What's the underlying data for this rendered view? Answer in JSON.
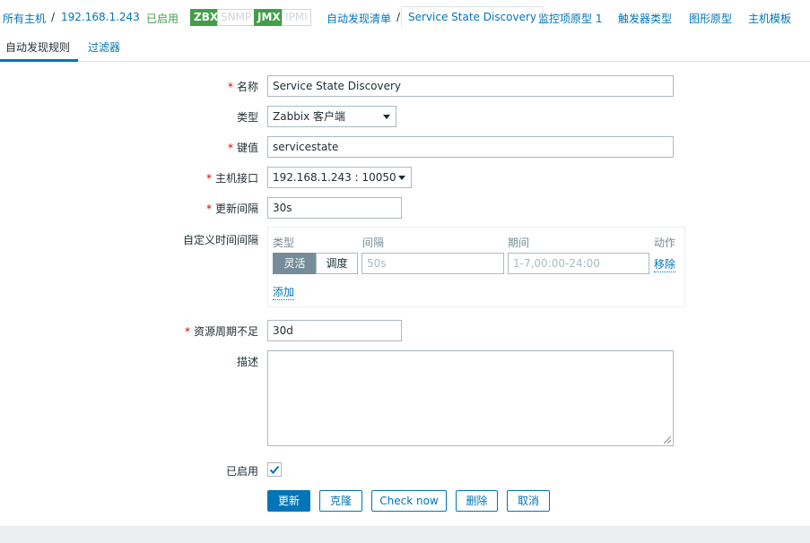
{
  "nav": {
    "all_hosts": "所有主机",
    "host": "192.168.1.243",
    "enabled": "已启用",
    "badges": [
      "ZBX",
      "SNMP",
      "JMX",
      "IPMI"
    ],
    "discovery_list": "自动发现清单",
    "current": "Service State Discovery",
    "item_prototypes": "监控项原型 1",
    "trigger_types": "触发器类型",
    "graph_prototypes": "图形原型",
    "host_templates": "主机模板"
  },
  "tabs": [
    "自动发现规则",
    "过滤器"
  ],
  "form": {
    "name_label": "名称",
    "name_value": "Service State Discovery",
    "type_label": "类型",
    "type_value": "Zabbix 客户端",
    "key_label": "键值",
    "key_value": "servicestate",
    "interface_label": "主机接口",
    "interface_value": "192.168.1.243 : 10050",
    "interval_label": "更新间隔",
    "interval_value": "30s",
    "custom_label": "自定义时间间隔",
    "custom_headers": [
      "类型",
      "间隔",
      "期间",
      "动作"
    ],
    "flexible": "灵活",
    "scheduling": "调度",
    "interval_placeholder": "50s",
    "period_placeholder": "1-7,00:00-24:00",
    "remove": "移除",
    "add": "添加",
    "lifetime_label": "资源周期不足",
    "lifetime_value": "30d",
    "description_label": "描述",
    "enabled_label": "已启用",
    "enabled_checked": true
  },
  "buttons": {
    "update": "更新",
    "clone": "克隆",
    "check_now": "Check now",
    "delete": "删除",
    "cancel": "取消"
  },
  "colors": {
    "link": "#0275b8",
    "enabled": "#429e47",
    "required": "#d40000"
  }
}
